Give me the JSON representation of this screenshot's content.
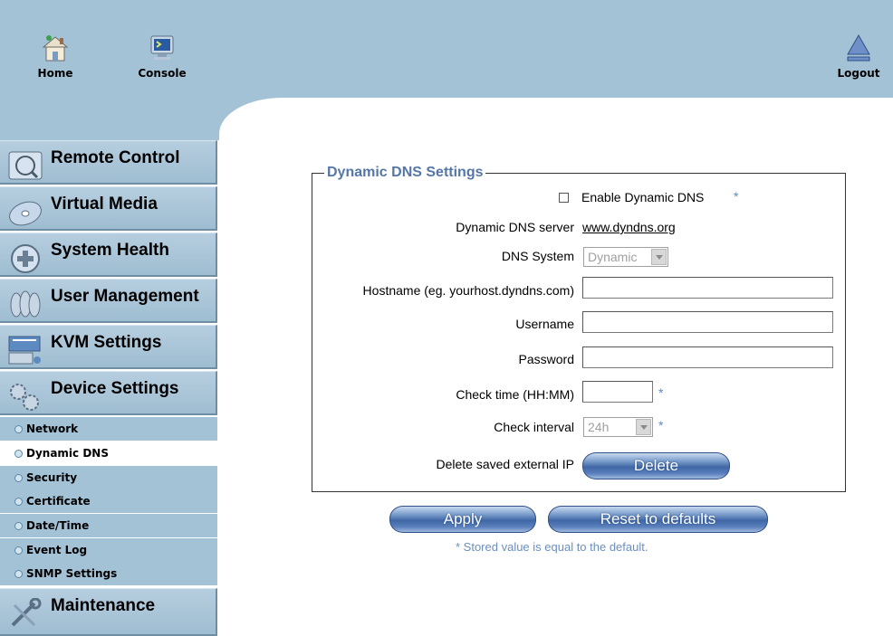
{
  "header": {
    "home_label": "Home",
    "console_label": "Console",
    "logout_label": "Logout"
  },
  "sidebar": {
    "main_items": [
      {
        "label": "Remote Control",
        "icon": "remote-control-icon"
      },
      {
        "label": "Virtual Media",
        "icon": "disc-icon"
      },
      {
        "label": "System Health",
        "icon": "health-icon"
      },
      {
        "label": "User Management",
        "icon": "users-icon"
      },
      {
        "label": "KVM Settings",
        "icon": "kvm-icon"
      },
      {
        "label": "Device Settings",
        "icon": "gears-icon"
      }
    ],
    "sub_items": [
      {
        "label": "Network",
        "active": false
      },
      {
        "label": "Dynamic DNS",
        "active": true
      },
      {
        "label": "Security",
        "active": false
      },
      {
        "label": "Certificate",
        "active": false
      },
      {
        "label": "Date/Time",
        "active": false
      },
      {
        "label": "Event Log",
        "active": false
      },
      {
        "label": "SNMP Settings",
        "active": false
      }
    ],
    "last_item": {
      "label": "Maintenance",
      "icon": "maintenance-icon"
    }
  },
  "form": {
    "legend": "Dynamic DNS Settings",
    "enable_label": "Enable Dynamic DNS",
    "enable_checked": false,
    "star": "*",
    "server_label": "Dynamic DNS server",
    "server_value": "www.dyndns.org",
    "dns_system_label": "DNS System",
    "dns_system_value": "Dynamic",
    "hostname_label": "Hostname (eg. yourhost.dyndns.com)",
    "hostname_value": "",
    "username_label": "Username",
    "username_value": "",
    "password_label": "Password",
    "password_value": "",
    "check_time_label": "Check time (HH:MM)",
    "check_time_value": "",
    "check_interval_label": "Check interval",
    "check_interval_value": "24h",
    "delete_ip_label": "Delete saved external IP",
    "delete_button": "Delete"
  },
  "actions": {
    "apply_button": "Apply",
    "reset_button": "Reset to defaults",
    "note": "* Stored value is equal to the default."
  },
  "colors": {
    "header_bg": "#a4c2d6",
    "legend_text": "#5577a8",
    "button_blue": "#3f67a6"
  }
}
